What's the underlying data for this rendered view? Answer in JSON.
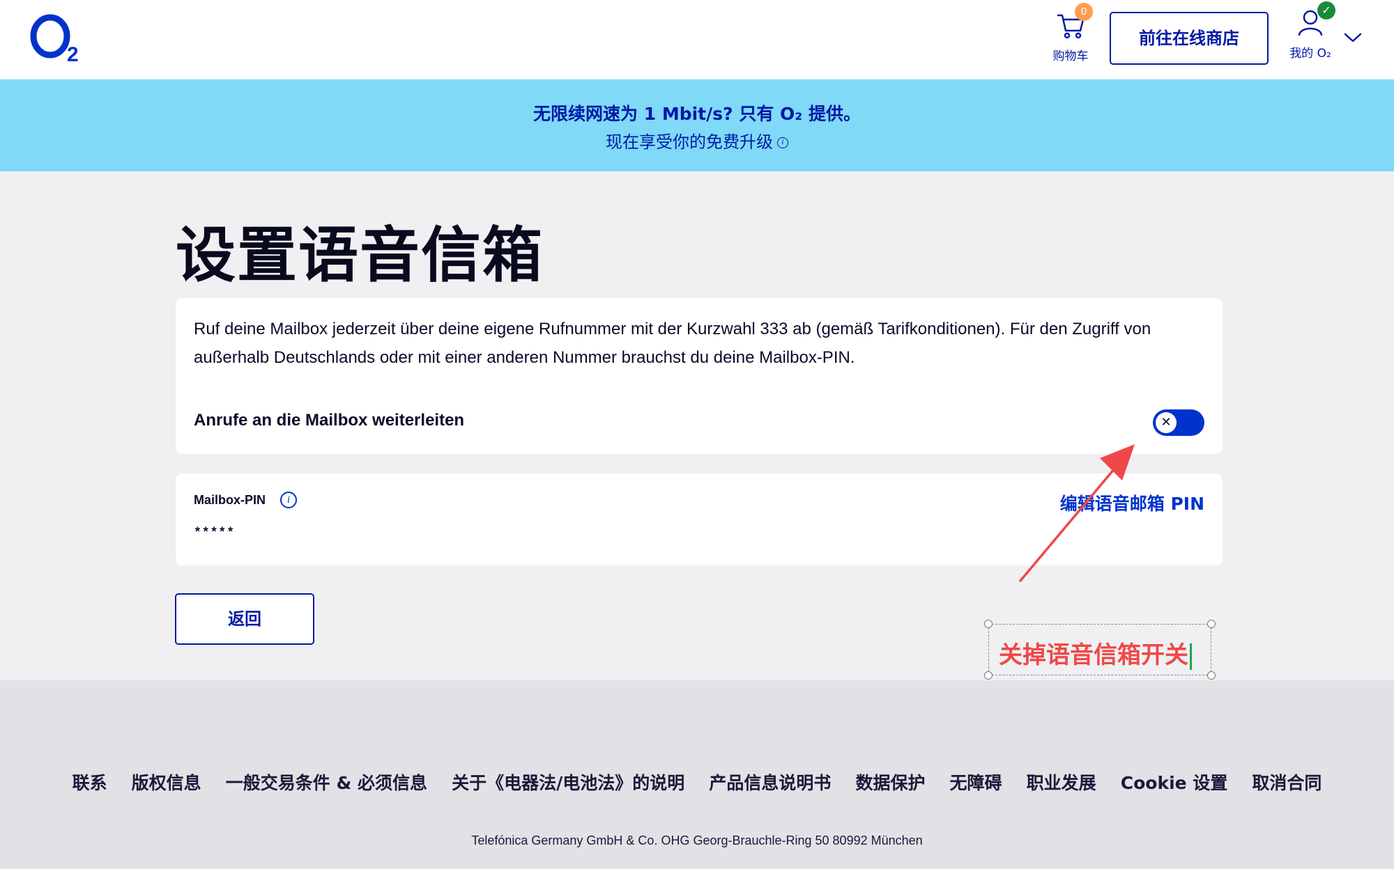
{
  "header": {
    "logo_text": "O₂",
    "cart_badge": "0",
    "cart_label": "购物车",
    "shop_button": "前往在线商店",
    "account_label": "我的 O₂"
  },
  "promo": {
    "line1": "无限续网速为 1 Mbit/s? 只有 O₂ 提供。",
    "line2": "现在享受你的免费升级"
  },
  "main": {
    "title": "设置语音信箱",
    "description": "Ruf deine Mailbox jederzeit über deine eigene Rufnummer mit der Kurzwahl 333 ab (gemäß Tarifkonditionen). Für den Zugriff von außerhalb Deutschlands oder mit einer anderen Nummer brauchst du deine Mailbox-PIN.",
    "forward_label": "Anrufe an die Mailbox weiterleiten",
    "forward_toggle_on": true,
    "pin_label": "Mailbox-PIN",
    "pin_value": "*****",
    "edit_pin": "编辑语音邮箱 PIN",
    "back_button": "返回"
  },
  "annotation": {
    "text": "关掉语音信箱开关",
    "color": "#f04848"
  },
  "footer": {
    "links": [
      "联系",
      "版权信息",
      "一般交易条件 & 必须信息",
      "关于《电器法/电池法》的说明",
      "产品信息说明书",
      "数据保护",
      "无障碍",
      "职业发展",
      "Cookie 设置",
      "取消合同"
    ],
    "address": "Telefónica Germany GmbH & Co. OHG Georg-Brauchle-Ring 50 80992 München"
  },
  "colors": {
    "brand": "#0019a5",
    "promo_bg": "#7fd9f7",
    "toggle": "#0033cc"
  }
}
